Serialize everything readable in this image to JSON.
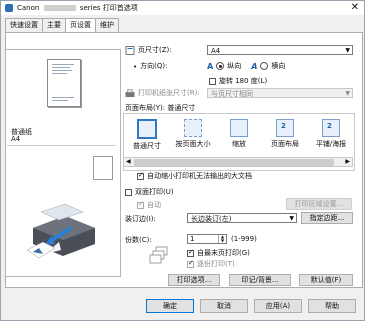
{
  "window": {
    "title_prefix": "Canon",
    "title_suffix": "series 打印首选项",
    "close": "✕"
  },
  "tabs": [
    "快速设置",
    "主要",
    "页设置",
    "维护"
  ],
  "preview": {
    "media_name": "普通纸",
    "media_size": "A4"
  },
  "page_size": {
    "label": "页尺寸(Z):",
    "value": "A4"
  },
  "orientation": {
    "label": "方向(Q):",
    "portrait": "纵向",
    "landscape": "横向",
    "selected": "portrait"
  },
  "rotate": {
    "label": "旋转 180 度(L)",
    "checked": false
  },
  "printer_paper": {
    "label": "打印机纸张尺寸(R):",
    "value": "与页尺寸相同"
  },
  "page_layout": {
    "label": "页面布局(Y): 普通尺寸",
    "options": [
      {
        "label": "普通尺寸",
        "icon": "normal-size-icon",
        "num": ""
      },
      {
        "label": "按页面大小",
        "icon": "fit-to-page-icon",
        "num": ""
      },
      {
        "label": "缩放",
        "icon": "scaled-icon",
        "num": ""
      },
      {
        "label": "页面布局",
        "icon": "page-layout-icon",
        "num": "2"
      },
      {
        "label": "平铺/海报",
        "icon": "tiling-poster-icon",
        "num": "2"
      }
    ],
    "selected_index": 0
  },
  "auto_reduce": {
    "label": "自动缩小打印机无法输出的大文档",
    "checked": true
  },
  "duplex": {
    "label": "双面打印(U)",
    "checked": false,
    "auto_label": "自动",
    "auto_checked": true,
    "area_button": "打印区域设置..."
  },
  "binding": {
    "label": "装订边(I):",
    "value": "长边装订(左)",
    "margin_button": "指定边距..."
  },
  "copies": {
    "label": "份数(C):",
    "value": "1",
    "range": "(1-999)",
    "reverse_label": "自最末页打印(G)",
    "reverse_checked": true,
    "collate_label": "逐份打印(T)",
    "collate_checked": true
  },
  "actions": {
    "print_options": "打印选项...",
    "stamp": "印记/背景...",
    "defaults": "默认值(F)"
  },
  "footer": {
    "ok": "确定",
    "cancel": "取消",
    "apply": "应用(A)",
    "help": "帮助"
  }
}
